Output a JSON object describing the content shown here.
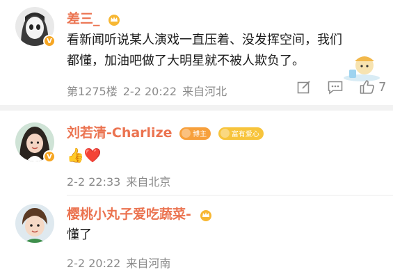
{
  "comments": [
    {
      "username": "差三_",
      "text": "看新闻听说某人演戏一直压着、没发挥空间，我们都懂，加油吧做了大明星就不被人欺负了。",
      "floor": "第1275楼",
      "time": "2-2 20:22",
      "location": "来自河北",
      "like_count": "7",
      "verified": "V"
    },
    {
      "username": "刘若清-Charlize",
      "badge_1": "博主",
      "badge_2": "富有爱心",
      "emoji_text": "👍❤️",
      "time": "2-2 22:33",
      "location": "来自北京",
      "verified": "V"
    },
    {
      "username": "樱桃小丸子爱吃蔬菜-",
      "text": "懂了",
      "time": "2-2 20:22",
      "location": "来自河南"
    }
  ],
  "icons": [
    "crown-icon",
    "verified-badge-icon",
    "edit-icon",
    "reply-comment-icon",
    "like-thumb-icon"
  ],
  "colors": {
    "username": "#eb7350",
    "meta": "#8a8a8a",
    "badge": "#f6a623"
  }
}
